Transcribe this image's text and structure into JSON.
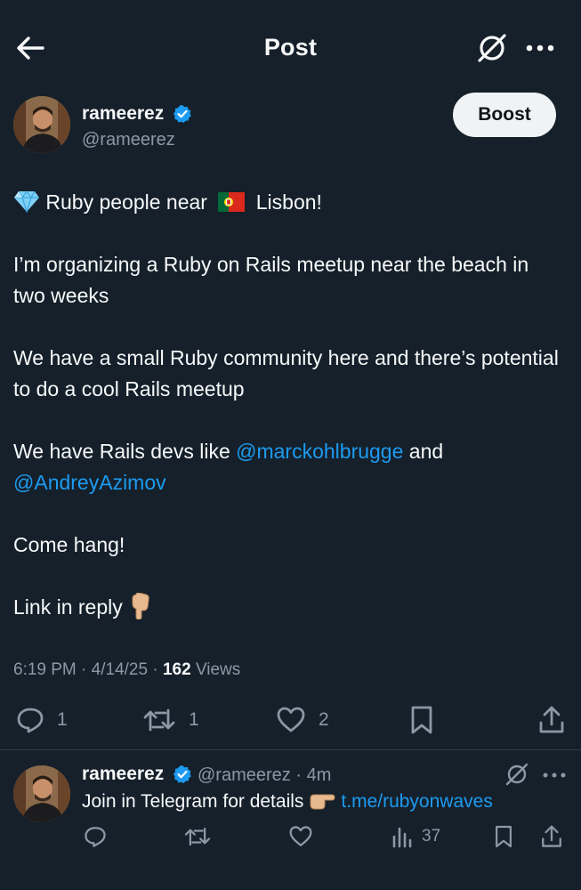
{
  "header": {
    "title": "Post",
    "back_icon": "arrow-left-icon",
    "grok_icon": "grok-icon",
    "more_icon": "more-dots-icon"
  },
  "post": {
    "author": {
      "name": "rameerez",
      "handle": "@rameerez",
      "verified": true
    },
    "boost_label": "Boost",
    "lines": {
      "l1_text": "Ruby people near",
      "l1_place": "Lisbon!",
      "p2": "I’m organizing a Ruby on Rails meetup near the beach in two weeks",
      "p3": "We have a small Ruby community here and there’s potential to do a cool Rails meetup",
      "p4_before": "We have Rails devs like ",
      "p4_mention1": "@marckohlbrugge",
      "p4_middle": " and",
      "p4_mention2": "@AndreyAzimov",
      "p5": "Come hang!",
      "p6": "Link in reply"
    },
    "meta": {
      "time": "6:19 PM",
      "date": "4/14/25",
      "views_count": "162",
      "views_label": "Views",
      "separator": "·"
    },
    "actions": {
      "replies": "1",
      "reposts": "1",
      "likes": "2"
    }
  },
  "reply": {
    "author": {
      "name": "rameerez",
      "handle": "@rameerez",
      "time": "4m",
      "separator": "·",
      "verified": true
    },
    "text": "Join in Telegram for details",
    "link": "t.me/rubyonwaves",
    "actions": {
      "views": "37"
    }
  },
  "colors": {
    "background": "#15202b",
    "text": "#f7f9f9",
    "muted": "#8b98a5",
    "link": "#1d9bf0",
    "verified": "#1d9bf0",
    "boost_bg": "#eff3f4"
  }
}
